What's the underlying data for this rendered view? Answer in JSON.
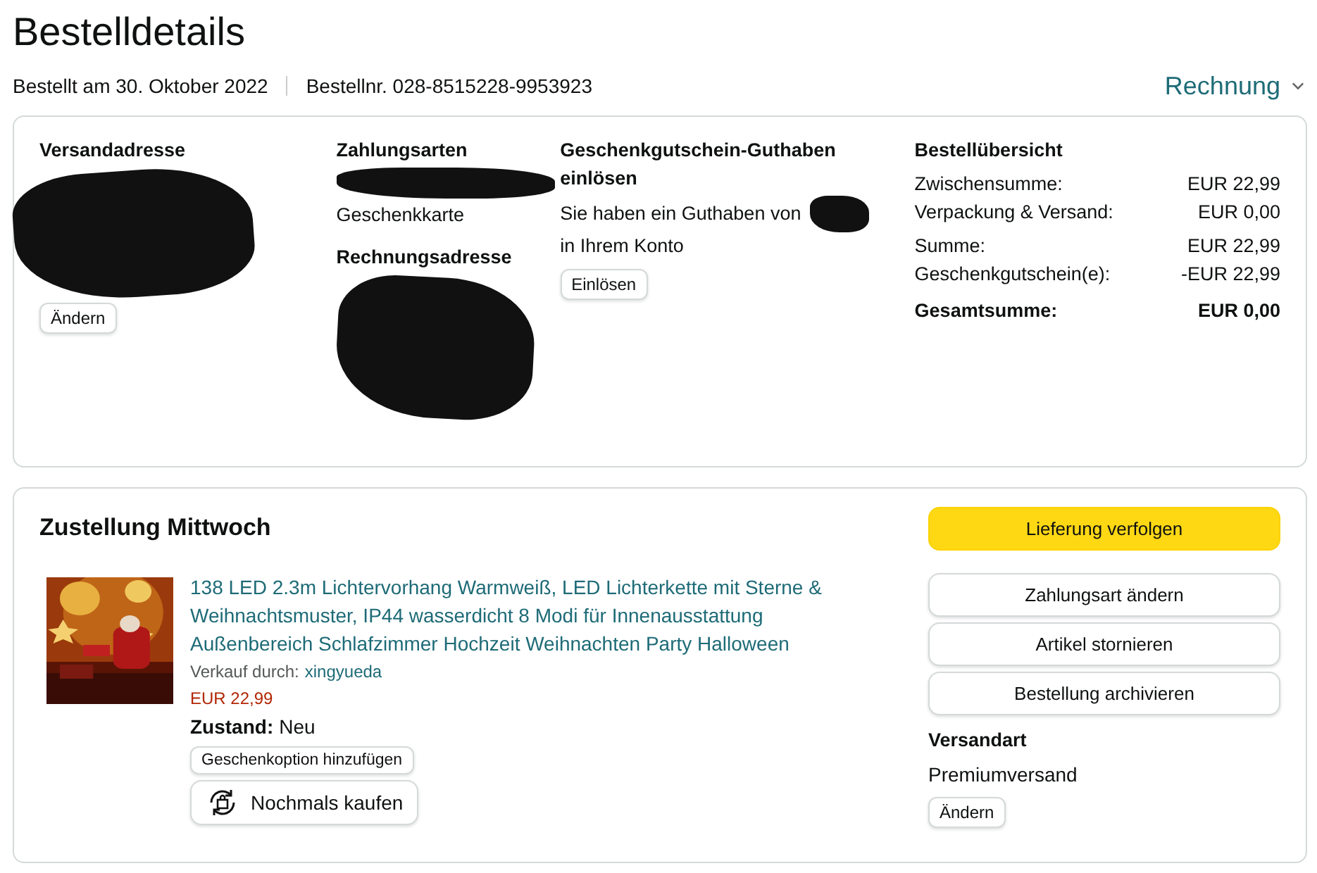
{
  "title": "Bestelldetails",
  "order_meta": {
    "date": "Bestellt am 30. Oktober 2022",
    "number": "Bestellnr. 028-8515228-9953923"
  },
  "invoice_menu": {
    "label": "Rechnung"
  },
  "summary_card": {
    "shipping_address": {
      "heading": "Versandadresse",
      "button": "Ändern"
    },
    "payment": {
      "heading": "Zahlungsarten",
      "method": "Geschenkkarte"
    },
    "billing_address": {
      "heading": "Rechnungsadresse"
    },
    "gift_card": {
      "heading": "Geschenkgutschein-Guthaben einlösen",
      "text_before": "Sie haben ein Guthaben von",
      "text_after": "in Ihrem Konto",
      "button": "Einlösen"
    },
    "order_summary": {
      "heading": "Bestellübersicht",
      "groups": [
        [
          {
            "label": "Zwischensumme:",
            "value": "EUR 22,99",
            "bold": false
          },
          {
            "label": "Verpackung & Versand:",
            "value": "EUR 0,00",
            "bold": false
          }
        ],
        [
          {
            "label": "Summe:",
            "value": "EUR 22,99",
            "bold": false
          },
          {
            "label": "Geschenkgutschein(e):",
            "value": "-EUR 22,99",
            "bold": false
          }
        ],
        [
          {
            "label": "Gesamtsumme:",
            "value": "EUR 0,00",
            "bold": true
          }
        ]
      ]
    }
  },
  "delivery_card": {
    "heading": "Zustellung Mittwoch",
    "item": {
      "title": "138 LED 2.3m Lichtervorhang Warmweiß, LED Lichterkette mit Sterne & Weihnachtsmuster, IP44 wasserdicht 8 Modi für Innenausstattung Außenbereich Schlafzimmer Hochzeit Weihnachten Party Halloween",
      "seller_label": "Verkauf durch:",
      "seller": "xingyueda",
      "price": "EUR 22,99",
      "condition_label": "Zustand:",
      "condition": "Neu",
      "gift_button": "Geschenkoption hinzufügen",
      "buy_again_button": "Nochmals kaufen"
    },
    "actions": [
      {
        "label": "Lieferung verfolgen",
        "kind": "primary"
      },
      {
        "label": "Zahlungsart ändern",
        "kind": "secondary"
      },
      {
        "label": "Artikel stornieren",
        "kind": "secondary"
      },
      {
        "label": "Bestellung archivieren",
        "kind": "secondary"
      }
    ],
    "shipping_method": {
      "heading": "Versandart",
      "value": "Premiumversand",
      "button": "Ändern"
    }
  }
}
